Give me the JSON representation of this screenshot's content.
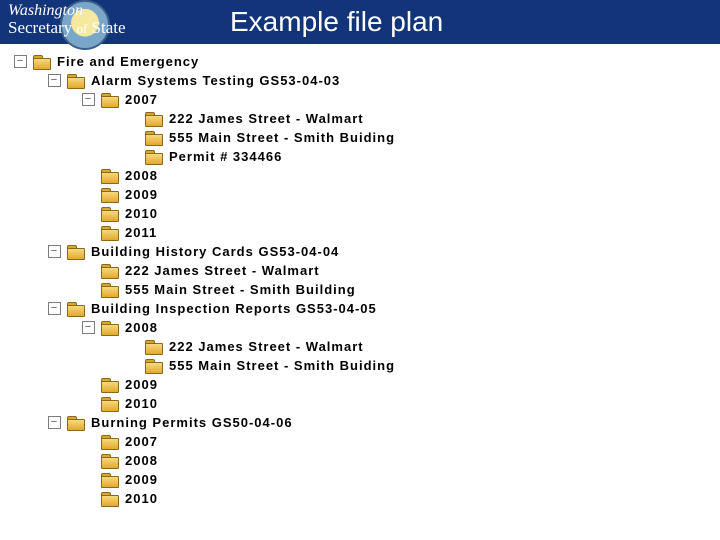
{
  "header": {
    "brand_top": "Washington",
    "brand_main_a": "Secretary",
    "brand_main_of": "of",
    "brand_main_b": "State",
    "title": "Example file plan"
  },
  "tree": {
    "root": "Fire and Emergency",
    "sections": [
      {
        "label": "Alarm Systems Testing GS53-04-03",
        "expandable": true,
        "children": [
          {
            "label": "2007",
            "depth": 2,
            "expandable": true,
            "children": [
              {
                "label": "222 James Street - Walmart",
                "depth": 3
              },
              {
                "label": "555 Main Street - Smith Buiding",
                "depth": 3
              },
              {
                "label": "Permit # 334466",
                "depth": 3
              }
            ]
          },
          {
            "label": "2008",
            "depth": 2
          },
          {
            "label": "2009",
            "depth": 2
          },
          {
            "label": "2010",
            "depth": 2
          },
          {
            "label": "2011",
            "depth": 2
          }
        ]
      },
      {
        "label": "Building History Cards GS53-04-04",
        "expandable": true,
        "children": [
          {
            "label": "222 James Street - Walmart",
            "depth": 2
          },
          {
            "label": "555 Main Street - Smith Building",
            "depth": 2
          }
        ]
      },
      {
        "label": "Building Inspection Reports GS53-04-05",
        "expandable": true,
        "children": [
          {
            "label": "2008",
            "depth": 2,
            "expandable": true,
            "children": [
              {
                "label": "222 James Street - Walmart",
                "depth": 3
              },
              {
                "label": "555 Main Street - Smith Buiding",
                "depth": 3
              }
            ]
          },
          {
            "label": "2009",
            "depth": 2
          },
          {
            "label": "2010",
            "depth": 2
          }
        ]
      },
      {
        "label": "Burning Permits GS50-04-06",
        "expandable": true,
        "children": [
          {
            "label": "2007",
            "depth": 2
          },
          {
            "label": "2008",
            "depth": 2
          },
          {
            "label": "2009",
            "depth": 2
          },
          {
            "label": "2010",
            "depth": 2
          }
        ]
      }
    ]
  }
}
